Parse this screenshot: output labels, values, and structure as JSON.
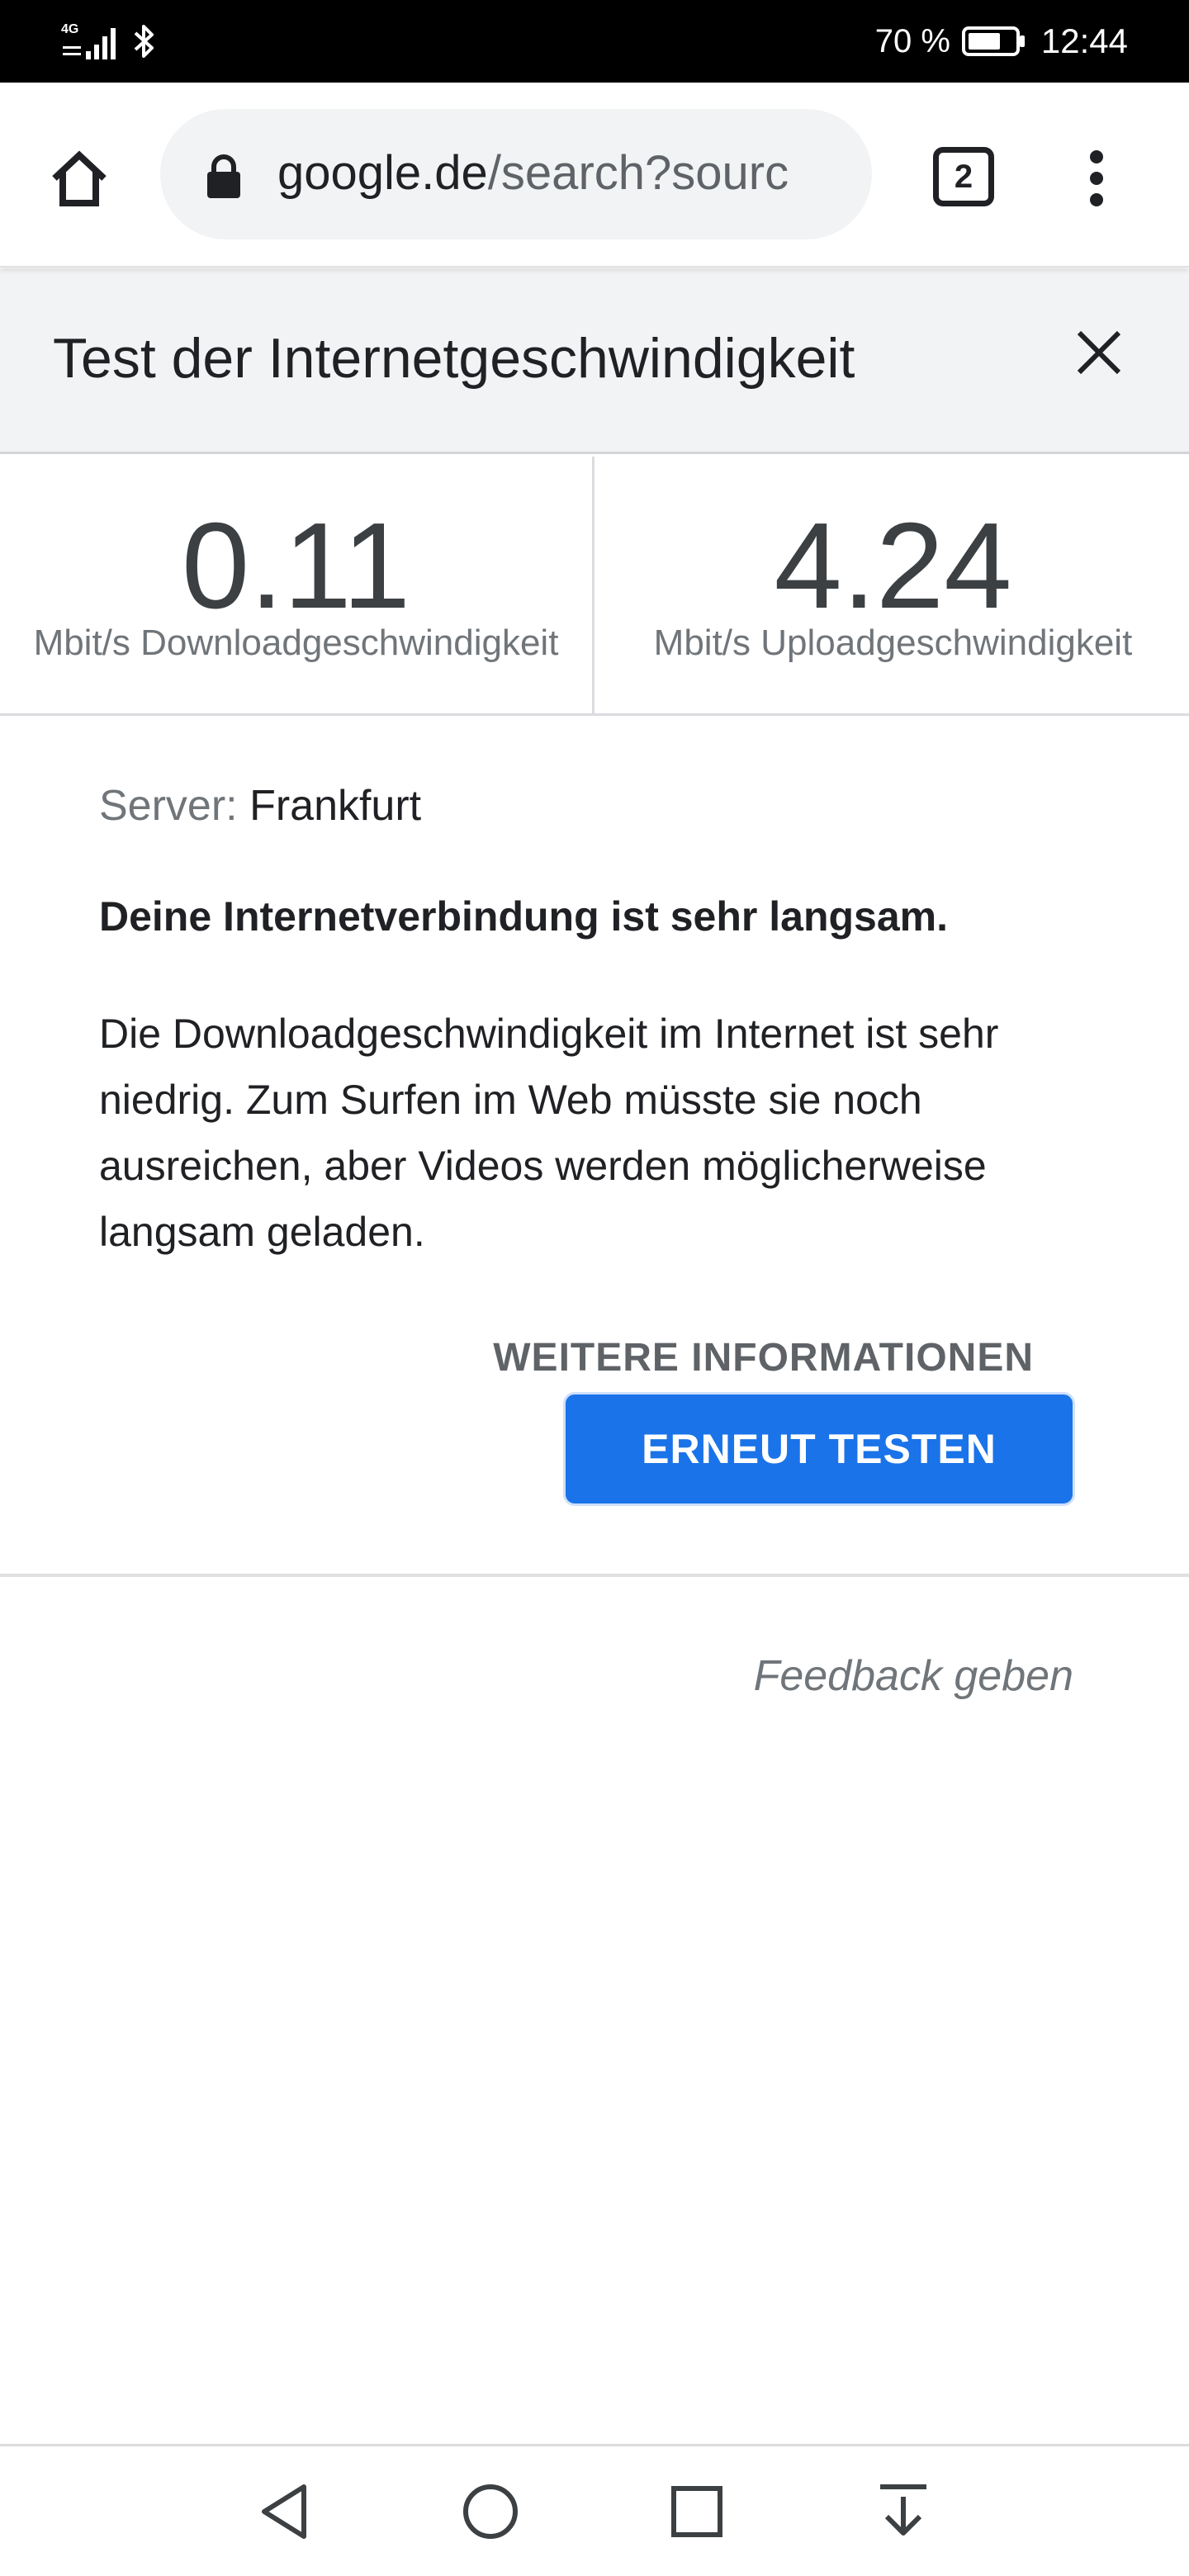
{
  "status_bar": {
    "network_type": "4G",
    "battery_percent": "70 %",
    "battery_level": 0.7,
    "time": "12:44"
  },
  "browser": {
    "url_host": "google.de",
    "url_path": "/search?sourc",
    "tab_count": "2"
  },
  "speed_test": {
    "title": "Test der Internetgeschwindigkeit",
    "download_value": "0.11",
    "download_label": "Mbit/s Downloadgeschwindigkeit",
    "upload_value": "4.24",
    "upload_label": "Mbit/s Uploadgeschwindigkeit",
    "server_label": "Server:",
    "server_name": "Frankfurt",
    "verdict": "Deine Internetverbindung ist sehr langsam.",
    "description": "Die Downloadgeschwindigkeit im Internet ist sehr niedrig. Zum Surfen im Web müsste sie noch ausreichen, aber Videos werden möglicherweise langsam geladen.",
    "more_info_label": "WEITERE INFORMATIONEN",
    "retest_label": "ERNEUT TESTEN",
    "feedback_label": "Feedback geben"
  },
  "colors": {
    "primary_blue": "#1a73e8",
    "header_background": "#f1f3f4",
    "muted_text": "#70757a"
  },
  "icons": {
    "home": "home-icon",
    "lock": "lock-icon",
    "tabs": "tab-switcher-icon",
    "menu": "more-vert-icon",
    "close": "close-icon",
    "nav_back": "triangle-back-icon",
    "nav_home": "circle-home-icon",
    "nav_recents": "square-recents-icon",
    "nav_notifications": "pull-down-notifications-icon"
  }
}
